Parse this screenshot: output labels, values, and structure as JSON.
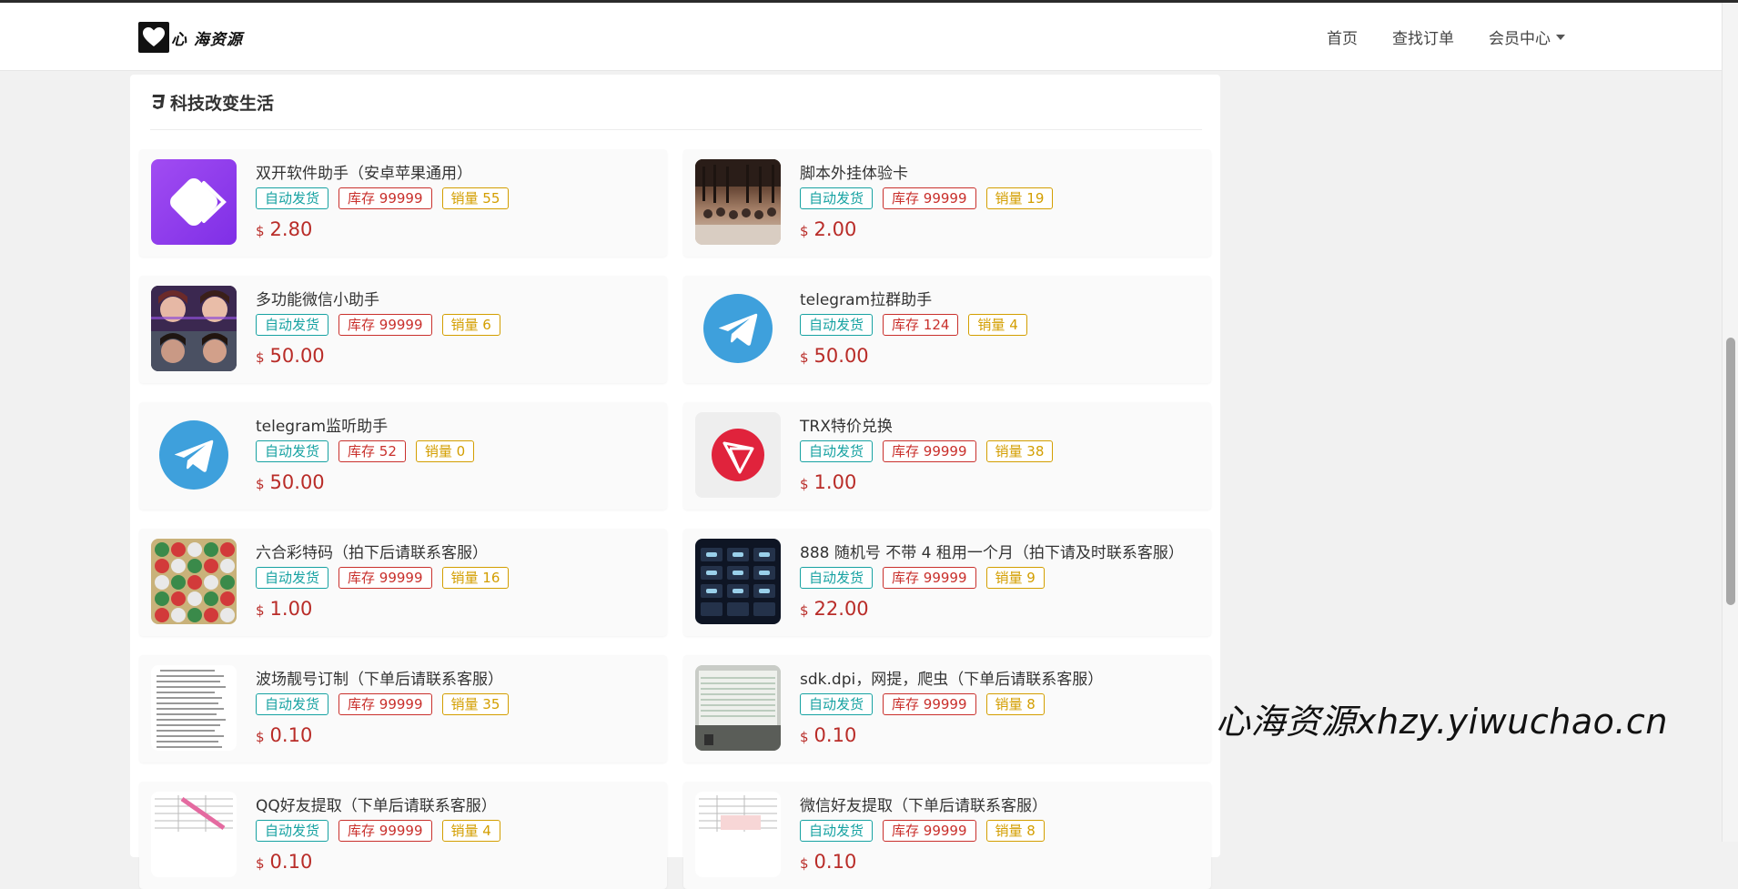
{
  "nav": {
    "brand_text": "心 海资源",
    "links": [
      "首页",
      "查找订单",
      "会员中心"
    ]
  },
  "category": {
    "title": "科技改变生活"
  },
  "products": [
    {
      "name": "双开软件助手（安卓苹果通用）",
      "tag_auto": "自动发货",
      "stock": "库存 99999",
      "sales": "销量 55",
      "currency": "$",
      "price": "2.80",
      "icon": "dual-app-icon"
    },
    {
      "name": "脚本外挂体验卡",
      "tag_auto": "自动发货",
      "stock": "库存 99999",
      "sales": "销量 19",
      "currency": "$",
      "price": "2.00",
      "icon": "concert-photo"
    },
    {
      "name": "多功能微信小助手",
      "tag_auto": "自动发货",
      "stock": "库存 99999",
      "sales": "销量 6",
      "currency": "$",
      "price": "50.00",
      "icon": "faces-collage-photo"
    },
    {
      "name": "telegram拉群助手",
      "tag_auto": "自动发货",
      "stock": "库存 124",
      "sales": "销量 4",
      "currency": "$",
      "price": "50.00",
      "icon": "telegram-icon"
    },
    {
      "name": "telegram监听助手",
      "tag_auto": "自动发货",
      "stock": "库存 52",
      "sales": "销量 0",
      "currency": "$",
      "price": "50.00",
      "icon": "telegram-icon"
    },
    {
      "name": "TRX特价兑换",
      "tag_auto": "自动发货",
      "stock": "库存 99999",
      "sales": "销量 38",
      "currency": "$",
      "price": "1.00",
      "icon": "tron-icon"
    },
    {
      "name": "六合彩特码（拍下后请联系客服）",
      "tag_auto": "自动发货",
      "stock": "库存 99999",
      "sales": "销量 16",
      "currency": "$",
      "price": "1.00",
      "icon": "lottery-balls-photo"
    },
    {
      "name": "888 随机号 不带 4 租用一个月（拍下请及时联系客服）",
      "tag_auto": "自动发货",
      "stock": "库存 99999",
      "sales": "销量 9",
      "currency": "$",
      "price": "22.00",
      "icon": "phone-screen-photo"
    },
    {
      "name": "波场靓号订制（下单后请联系客服）",
      "tag_auto": "自动发货",
      "stock": "库存 99999",
      "sales": "销量 35",
      "currency": "$",
      "price": "0.10",
      "icon": "text-list-photo"
    },
    {
      "name": "sdk.dpi，网提，爬虫（下单后请联系客服）",
      "tag_auto": "自动发货",
      "stock": "库存 99999",
      "sales": "销量 8",
      "currency": "$",
      "price": "0.10",
      "icon": "monitor-photo"
    },
    {
      "name": "QQ好友提取（下单后请联系客服）",
      "tag_auto": "自动发货",
      "stock": "库存 99999",
      "sales": "销量 4",
      "currency": "$",
      "price": "0.10",
      "icon": "spreadsheet-photo"
    },
    {
      "name": "微信好友提取（下单后请联系客服）",
      "tag_auto": "自动发货",
      "stock": "库存 99999",
      "sales": "销量 8",
      "currency": "$",
      "price": "0.10",
      "icon": "spreadsheet-photo"
    }
  ],
  "watermark": "心海资源xhzy.yiwuchao.cn"
}
